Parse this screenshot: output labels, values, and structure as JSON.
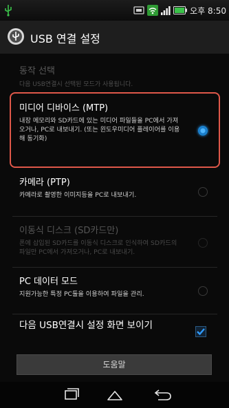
{
  "status_bar": {
    "time": "오후 8:50",
    "icons": [
      "usb-icon",
      "screenshot-icon",
      "wifi-icon",
      "signal-icon",
      "battery-icon"
    ]
  },
  "title_bar": {
    "title": "USB 연결 설정",
    "icon": "usb-settings-icon"
  },
  "section": {
    "title": "동작 선택",
    "description": "다음 USB연결시 선택된 모드가 사용됩니다."
  },
  "options": [
    {
      "title": "미디어 디바이스 (MTP)",
      "description": "내장 메모리와 SD카드에 있는 미디어 파일들을 PC에서 가져오거나, PC로 내보내기. (또는 윈도우미디어 플레이어를 이용해 동기화)",
      "selected": true,
      "enabled": true
    },
    {
      "title": "카메라 (PTP)",
      "description": "카메라로 촬영한 이미지등을 PC로 내보내기.",
      "selected": false,
      "enabled": true
    },
    {
      "title": "이동식 디스크 (SD카드만)",
      "description": "폰에 삽입된 SD카드를 이동식 디스크로 인식하여 SD카드의 파일만 PC에서 가져오거나, PC로 내보내기.",
      "selected": false,
      "enabled": false
    },
    {
      "title": "PC 데이터 모드",
      "description": "지원가능한 특정 PC툴을 이용하여 파일을 관리.",
      "selected": false,
      "enabled": true
    }
  ],
  "checkbox": {
    "label": "다음 USB연결시 설정 화면 보이기",
    "checked": true
  },
  "help_button": {
    "label": "도움말"
  },
  "nav_bar": {
    "buttons": [
      "recent-apps-icon",
      "home-icon",
      "back-icon"
    ]
  },
  "colors": {
    "accent": "#1b8ad8",
    "highlight": "#e0584a"
  }
}
